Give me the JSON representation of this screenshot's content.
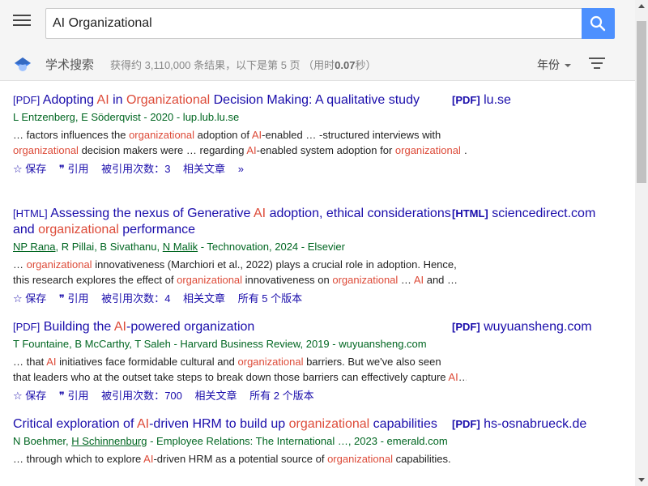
{
  "search": {
    "query": "AI Organizational"
  },
  "header": {
    "title": "学术搜索",
    "stats_prefix": "获得约 3,110,000 条结果，以下是第 5 页 （用时",
    "stats_time": "0.07",
    "stats_suffix": "秒）",
    "year_label": "年份"
  },
  "actions": {
    "save": "保存",
    "cite": "引用",
    "cited_prefix": "被引用次数：",
    "related": "相关文章"
  },
  "results": [
    {
      "tag": "[PDF]",
      "title": [
        "Adopting ",
        "AI",
        " in ",
        "Organizational",
        " Decision Making: A qualitative study"
      ],
      "authors": "L Entzenberg, E Söderqvist - 2020 - lup.lub.lu.se",
      "snippet1": [
        "… factors influences the ",
        "organizational",
        " adoption of ",
        "AI",
        "-enabled … -structured interviews with"
      ],
      "snippet2": [
        "organizational",
        " decision makers were … regarding ",
        "AI",
        "-enabled system adoption for ",
        "organizational",
        " …"
      ],
      "cited": "3",
      "versions": "",
      "side_tag": "[PDF]",
      "side_domain": "lu.se"
    },
    {
      "tag": "[HTML]",
      "title": [
        "Assessing the nexus of Generative ",
        "AI",
        " adoption, ethical considerations and ",
        "organizational",
        " performance"
      ],
      "authors_parts": [
        "NP Rana",
        ", R Pillai, B Sivathanu, ",
        "N Malik",
        " - Technovation, 2024 - Elsevier"
      ],
      "snippet1": [
        "… ",
        "organizational",
        " innovativeness (Marchiori et al., 2022) plays a crucial role in adoption. Hence,"
      ],
      "snippet2": [
        "this research explores the effect of ",
        "organizational",
        " innovativeness on ",
        "organizational",
        " … ",
        "AI",
        " and …"
      ],
      "cited": "4",
      "versions": "所有 5 个版本",
      "side_tag": "[HTML]",
      "side_domain": "sciencedirect.com"
    },
    {
      "tag": "[PDF]",
      "title": [
        "Building the ",
        "AI",
        "-powered organization"
      ],
      "authors": "T Fountaine, B McCarthy, T Saleh - Harvard Business Review, 2019 - wuyuansheng.com",
      "snippet1": [
        "… that ",
        "AI",
        " initiatives face formidable cultural and ",
        "organizational",
        " barriers. But we've also seen"
      ],
      "snippet2": [
        "that leaders who at the outset take steps to break down those barriers can effectively capture ",
        "AI",
        "…"
      ],
      "cited": "700",
      "versions": "所有 2 个版本",
      "side_tag": "[PDF]",
      "side_domain": "wuyuansheng.com"
    },
    {
      "tag": "",
      "title": [
        "Critical exploration of ",
        "AI",
        "-driven HRM to build up ",
        "organizational",
        " capabilities"
      ],
      "authors_parts": [
        "N Boehmer, ",
        "H Schinnenburg",
        " - Employee Relations: The International …, 2023 - emerald.com"
      ],
      "snippet1": [
        "… through which to explore ",
        "AI",
        "-driven HRM as a potential source of ",
        "organizational",
        " capabilities."
      ],
      "cited": "",
      "versions": "",
      "side_tag": "[PDF]",
      "side_domain": "hs-osnabrueck.de"
    }
  ]
}
